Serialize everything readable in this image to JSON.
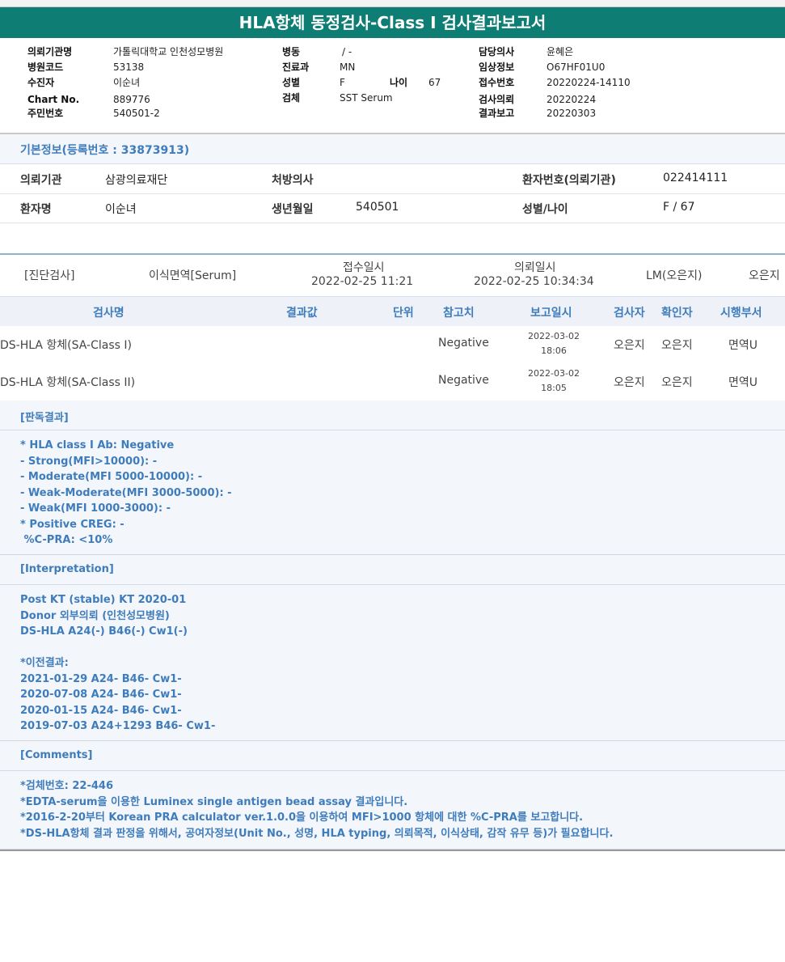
{
  "title": "HLA항체 동정검사-Class I 검사결과보고서",
  "header": {
    "col1": [
      {
        "label": "의뢰기관명",
        "value": "가톨릭대학교 인천성모병원"
      },
      {
        "label": "병원코드",
        "value": "53138"
      },
      {
        "label": "수진자",
        "value": "이순녀"
      },
      {
        "label": "Chart No.",
        "value": "889776"
      },
      {
        "label": "주민번호",
        "value": "540501-2"
      }
    ],
    "col2": [
      {
        "label": "병동",
        "value": "/ -"
      },
      {
        "label": "진료과",
        "value": "MN"
      },
      {
        "label": "성별",
        "value": "F"
      },
      {
        "label": "검체",
        "value": "SST Serum"
      }
    ],
    "age_label": "나이",
    "age_value": "67",
    "col3": [
      {
        "label": "담당의사",
        "value": "윤혜은"
      },
      {
        "label": "임상정보",
        "value": "O67HF01U0"
      },
      {
        "label": "접수번호",
        "value": "20220224-14110"
      },
      {
        "label": "검사의뢰",
        "value": "20220224"
      },
      {
        "label": "결과보고",
        "value": "20220303"
      }
    ]
  },
  "basic": {
    "heading": "기본정보(등록번호 : 33873913)",
    "row1": {
      "l1": "의뢰기관",
      "v1": "삼광의료재단",
      "l2": "처방의사",
      "v2": "",
      "l3": "환자번호(의뢰기관)",
      "v3": "022414111"
    },
    "row2": {
      "l1": "환자명",
      "v1": "이순녀",
      "l2": "생년월일",
      "v2": "540501",
      "l3": "성별/나이",
      "v3": "F / 67"
    }
  },
  "exam": {
    "category": "[진단검사]",
    "name": "이식면역[Serum]",
    "received_label": "접수일시",
    "received": "2022-02-25  11:21",
    "requested_label": "의뢰일시",
    "requested": "2022-02-25  10:34:34",
    "lm": "LM(오은지)",
    "person": "오은지"
  },
  "table": {
    "headers": {
      "name": "검사명",
      "result": "결과값",
      "unit": "단위",
      "ref": "참고치",
      "report": "보고일시",
      "tester": "검사자",
      "checker": "확인자",
      "dept": "시행부서"
    },
    "rows": [
      {
        "name": "DS-HLA 항체(SA-Class I)",
        "result": "",
        "unit": "",
        "ref": "Negative",
        "date": "2022-03-02",
        "time": "18:06",
        "tester": "오은지",
        "checker": "오은지",
        "dept": "면역U"
      },
      {
        "name": "DS-HLA 항체(SA-Class II)",
        "result": "",
        "unit": "",
        "ref": "Negative",
        "date": "2022-03-02",
        "time": "18:05",
        "tester": "오은지",
        "checker": "오은지",
        "dept": "면역U"
      }
    ]
  },
  "reading": {
    "heading": "[판독결과]",
    "lines": [
      "* HLA class I Ab: Negative",
      "- Strong(MFI>10000): -",
      "- Moderate(MFI 5000-10000): -",
      "- Weak-Moderate(MFI 3000-5000): -",
      "- Weak(MFI 1000-3000): -",
      "* Positive CREG: -",
      " %C-PRA: <10%"
    ]
  },
  "interpretation": {
    "heading": "[Interpretation]",
    "lines": [
      "Post KT (stable) KT 2020-01",
      "Donor 외부의뢰 (인천성모병원)",
      "DS-HLA A24(-) B46(-) Cw1(-)",
      "",
      "*이전결과:",
      "2021-01-29 A24- B46- Cw1-",
      "2020-07-08 A24- B46- Cw1-",
      "2020-01-15 A24- B46- Cw1-",
      "2019-07-03 A24+1293 B46- Cw1-"
    ]
  },
  "comments": {
    "heading": "[Comments]",
    "lines": [
      "*검체번호: 22-446",
      "*EDTA-serum을 이용한 Luminex single antigen bead assay 결과입니다.",
      "*2016-2-20부터 Korean PRA calculator ver.1.0.0을 이용하여 MFI>1000 항체에 대한 %C-PRA를 보고합니다.",
      "*DS-HLA항체 결과 판정을 위해서, 공여자정보(Unit No., 성명, HLA typing, 의뢰목적, 이식상태, 감작 유무 등)가 필요합니다."
    ]
  }
}
